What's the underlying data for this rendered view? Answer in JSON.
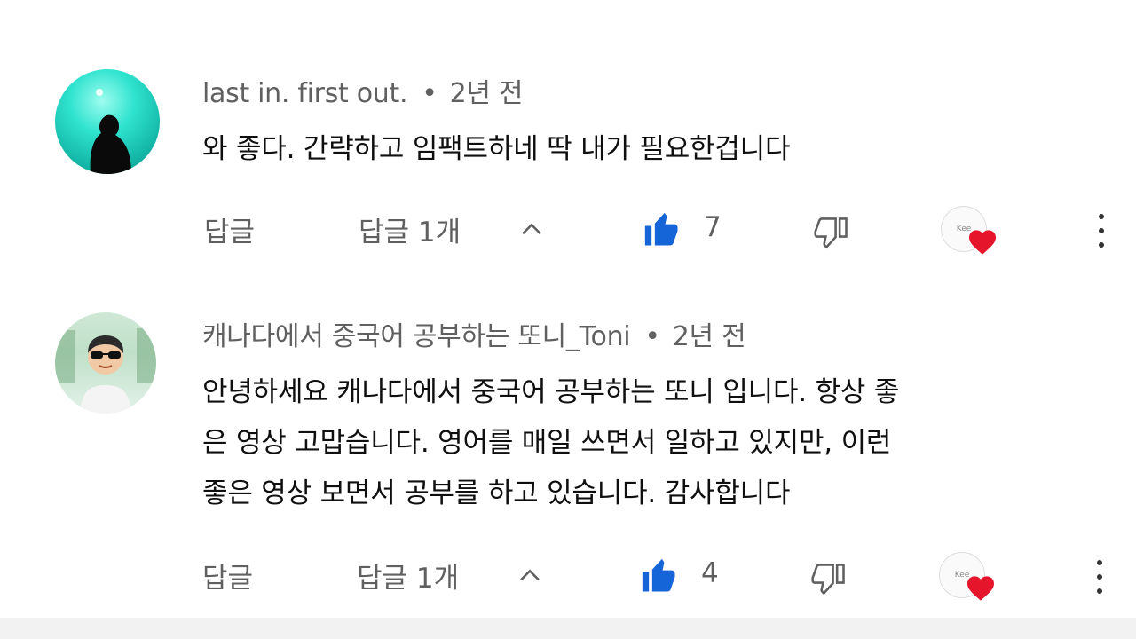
{
  "comments": [
    {
      "author": "last in. first out.",
      "time": "2년 전",
      "lines": [
        "와 좋다. 간략하고 임팩트하네 딱 내가 필요한겁니다"
      ],
      "reply_label": "답글",
      "replies_label": "답글 1개",
      "likes": "7",
      "creator_badge": "Kee"
    },
    {
      "author": "캐나다에서 중국어 공부하는 또니_Toni",
      "time": "2년 전",
      "lines": [
        "안녕하세요 캐나다에서 중국어 공부하는 또니 입니다.   항상 좋",
        "은 영상 고맙습니다.   영어를 매일 쓰면서 일하고 있지만, 이런",
        "좋은 영상 보면서 공부를 하고 있습니다. 감사합니다"
      ],
      "reply_label": "답글",
      "replies_label": "답글 1개",
      "likes": "4",
      "creator_badge": "Kee"
    }
  ],
  "colors": {
    "like_blue": "#1565d8",
    "muted": "#606060",
    "heart": "#e5152c"
  },
  "icons": [
    "thumbs-up-icon",
    "thumbs-down-icon",
    "chevron-up-icon",
    "creator-heart-icon",
    "more-vert-icon"
  ]
}
